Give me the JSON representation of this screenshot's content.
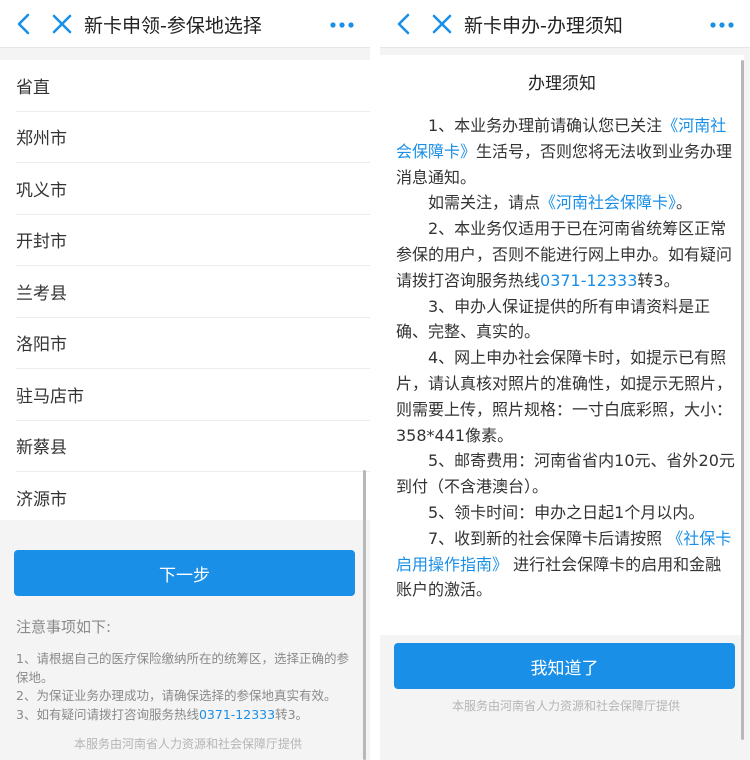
{
  "colors": {
    "accent": "#1a8fe8",
    "nav_icon": "#1a8fe8"
  },
  "left": {
    "title": "新卡申领-参保地选择",
    "icons": {
      "back": "chevron-left-icon",
      "close": "close-icon",
      "more": "more-dots-icon"
    },
    "items": [
      "省直",
      "郑州市",
      "巩义市",
      "开封市",
      "兰考县",
      "洛阳市",
      "驻马店市",
      "新蔡县",
      "济源市"
    ],
    "button": "下一步",
    "notes_title": "注意事项如下:",
    "notes": {
      "n1": "1、请根据自己的医疗保险缴纳所在的统筹区，选择正确的参保地。",
      "n2": "2、为保证业务办理成功，请确保选择的参保地真实有效。",
      "n3_pre": "3、如有疑问请拨打咨询服务热线",
      "n3_link": "0371-12333",
      "n3_post": "转3。"
    },
    "footer": "本服务由河南省人力资源和社会保障厅提供"
  },
  "right": {
    "title": "新卡申办-办理须知",
    "card_title": "办理须知",
    "p1": {
      "a": "1、本业务办理前请确认您已关注",
      "link": "《河南社会保障卡》",
      "b": "生活号，否则您将无法收到业务办理消息通知。"
    },
    "p2": {
      "a": "如需关注，请点",
      "link": "《河南社会保障卡》",
      "b": "。"
    },
    "p3": {
      "a": "2、本业务仅适用于已在河南省统筹区正常参保的用户，否则不能进行网上申办。如有疑问请拨打咨询服务热线",
      "link": "0371-12333",
      "b": "转3。"
    },
    "p4": "3、申办人保证提供的所有申请资料是正确、完整、真实的。",
    "p5": "4、网上申办社会保障卡时，如提示已有照片，请认真核对照片的准确性，如提示无照片，则需要上传，照片规格：一寸白底彩照，大小：358*441像素。",
    "p6": "5、邮寄费用：河南省省内10元、省外20元到付（不含港澳台）。",
    "p7": "5、领卡时间：申办之日起1个月以内。",
    "p8": {
      "a": "7、收到新的社会保障卡后请按照 ",
      "link": "《社保卡启用操作指南》",
      "b": " 进行社会保障卡的启用和金融账户的激活。"
    },
    "button": "我知道了",
    "footer": "本服务由河南省人力资源和社会保障厅提供"
  }
}
